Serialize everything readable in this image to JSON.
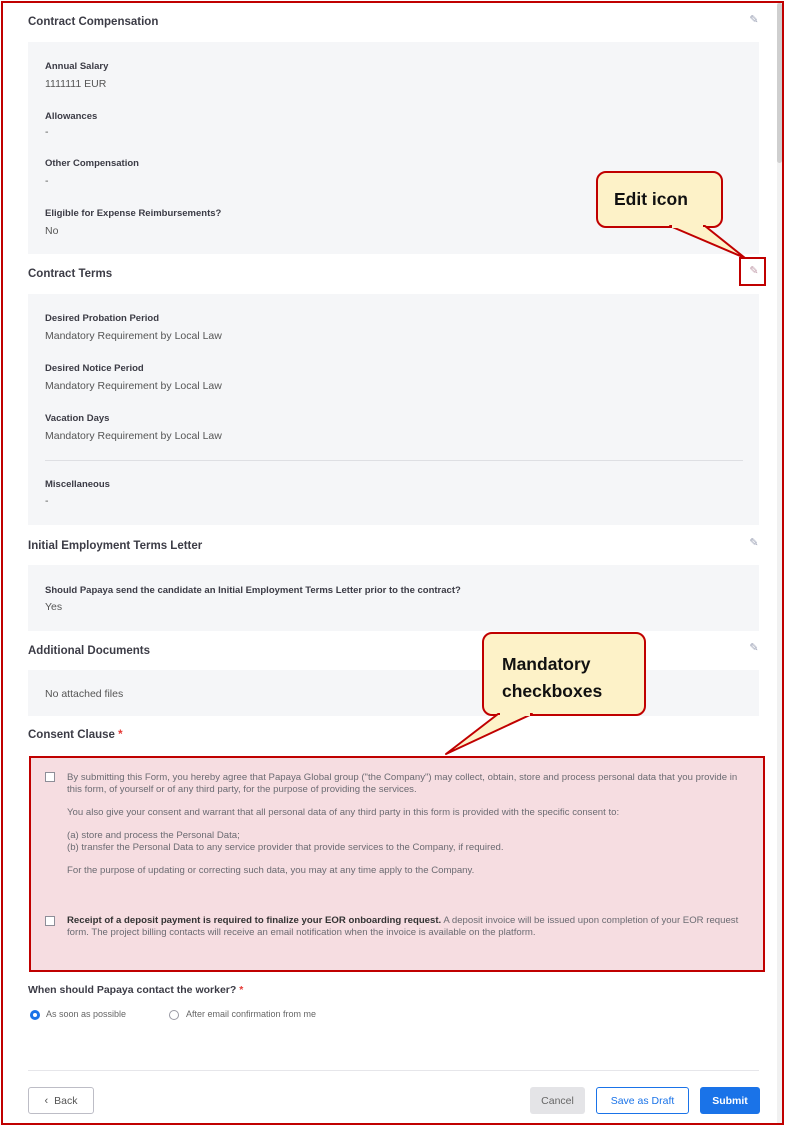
{
  "compensation": {
    "title": "Contract Compensation",
    "fields": [
      {
        "label": "Annual Salary",
        "value": "1111111 EUR"
      },
      {
        "label": "Allowances",
        "value": "-"
      },
      {
        "label": "Other Compensation",
        "value": "-"
      },
      {
        "label": "Eligible for Expense Reimbursements?",
        "value": "No"
      }
    ]
  },
  "terms": {
    "title": "Contract Terms",
    "fields": [
      {
        "label": "Desired Probation Period",
        "value": "Mandatory Requirement by Local Law"
      },
      {
        "label": "Desired Notice Period",
        "value": "Mandatory Requirement by Local Law"
      },
      {
        "label": "Vacation Days",
        "value": "Mandatory Requirement by Local Law"
      },
      {
        "label": "Miscellaneous",
        "value": "-"
      }
    ]
  },
  "letter": {
    "title": "Initial Employment Terms Letter",
    "question": "Should Papaya send the candidate an Initial Employment Terms Letter prior to the contract?",
    "answer": "Yes"
  },
  "documents": {
    "title": "Additional Documents",
    "empty_text": "No attached files"
  },
  "callouts": {
    "edit_icon": "Edit icon",
    "mandatory_line1": "Mandatory",
    "mandatory_line2": "checkboxes"
  },
  "consent": {
    "title": "Consent Clause",
    "required_mark": "*",
    "item1_p1": "By submitting this Form, you hereby agree that Papaya Global group (\"the Company\") may collect, obtain, store and process personal data that you provide in this form, of yourself or of any third party, for the purpose of providing the services.",
    "item1_p2": "You also give your consent and warrant that all personal data of any third party in this form is provided with the specific consent to:",
    "item1_p3a": "(a) store and process the Personal Data;",
    "item1_p3b": "(b) transfer the Personal Data to any service provider that provide services to the Company, if required.",
    "item1_p4": "For the purpose of updating or correcting such data, you may at any time apply to the Company.",
    "item2_bold": "Receipt of a deposit payment is required to finalize your EOR onboarding request.",
    "item2_rest": " A deposit invoice will be issued upon completion of your EOR request form. The project billing contacts will receive an email notification when the invoice is available on the platform.",
    "item1_checked": false,
    "item2_checked": false
  },
  "contact": {
    "question": "When should Papaya contact the worker?",
    "required_mark": "*",
    "options": [
      "As soon as possible",
      "After email confirmation from me"
    ],
    "selected": "As soon as possible"
  },
  "footer": {
    "back_label": "Back",
    "back_icon": "chevron-left-icon",
    "cancel_label": "Cancel",
    "draft_label": "Save as Draft",
    "submit_label": "Submit"
  },
  "colors": {
    "accent": "#1a73e8",
    "annotation_red": "#c00000",
    "callout_fill": "#fdf2c8",
    "consent_fill": "#f6dde1"
  }
}
